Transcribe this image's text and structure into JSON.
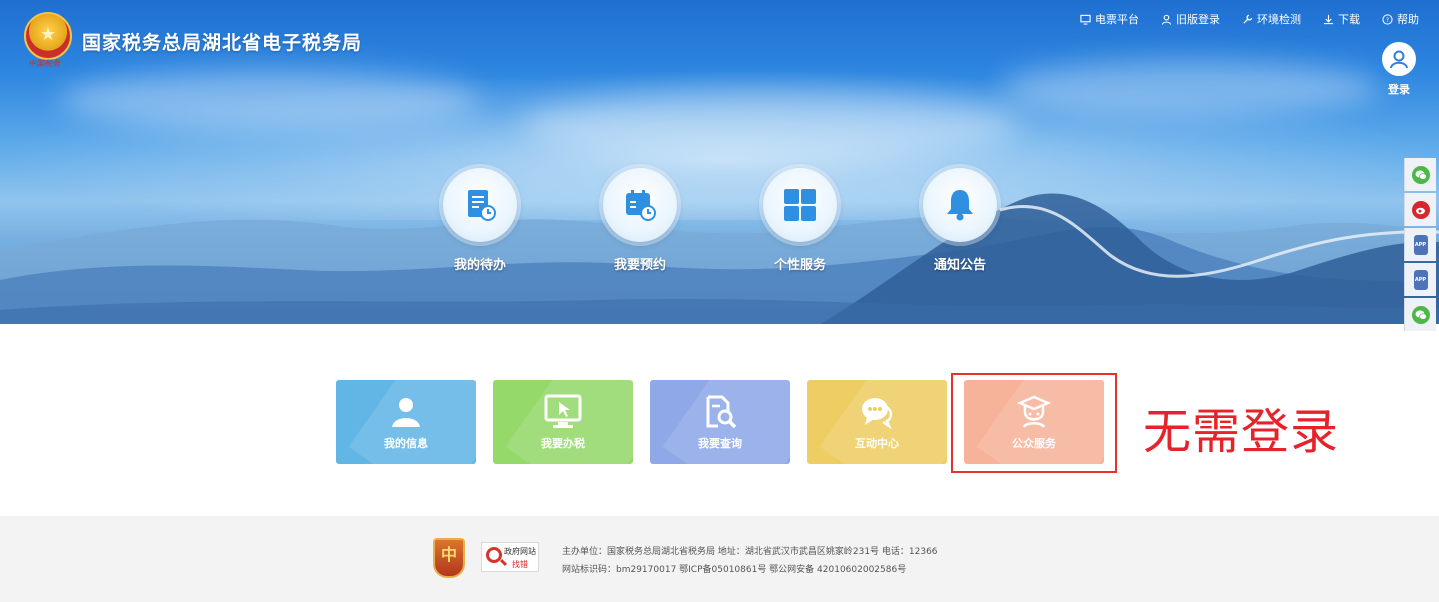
{
  "header": {
    "site_title": "国家税务总局湖北省电子税务局",
    "logo_signature": "中国税务"
  },
  "topnav": [
    {
      "label": "电票平台",
      "icon": "monitor-icon"
    },
    {
      "label": "旧版登录",
      "icon": "user-icon"
    },
    {
      "label": "环境检测",
      "icon": "wrench-icon"
    },
    {
      "label": "下载",
      "icon": "download-icon"
    },
    {
      "label": "帮助",
      "icon": "help-icon"
    }
  ],
  "login": {
    "label": "登录"
  },
  "quick_links": [
    {
      "label": "我的待办",
      "icon": "document-clock-icon"
    },
    {
      "label": "我要预约",
      "icon": "calendar-clock-icon"
    },
    {
      "label": "个性服务",
      "icon": "grid-icon"
    },
    {
      "label": "通知公告",
      "icon": "bell-icon"
    }
  ],
  "sidebar": [
    {
      "icon": "wechat-icon",
      "color": "#4cb848"
    },
    {
      "icon": "weibo-icon",
      "color": "#d6272d"
    },
    {
      "icon": "app-icon",
      "label": "APP",
      "color": "#4f73b8"
    },
    {
      "icon": "app-icon",
      "label": "APP",
      "color": "#4f73b8"
    },
    {
      "icon": "wechat-icon",
      "color": "#4cb848"
    }
  ],
  "tiles": [
    {
      "label": "我的信息",
      "icon": "person-icon",
      "color": "#62b6e6"
    },
    {
      "label": "我要办税",
      "icon": "monitor-cursor-icon",
      "color": "#96d96b"
    },
    {
      "label": "我要查询",
      "icon": "document-search-icon",
      "color": "#8fa8e8"
    },
    {
      "label": "互动中心",
      "icon": "chat-bubble-icon",
      "color": "#eecd63"
    },
    {
      "label": "公众服务",
      "icon": "graduate-icon",
      "color": "#f6b39a"
    }
  ],
  "annotation": {
    "text": "无需登录",
    "color": "#e6232a"
  },
  "footer": {
    "badge1_text": "中",
    "badge2_top": "政府网站",
    "badge2_bottom": "找错",
    "line1": "主办单位：国家税务总局湖北省税务局    地址：湖北省武汉市武昌区姚家岭231号  电话：12366",
    "line2": "网站标识码：bm29170017    鄂ICP备05010861号   鄂公网安备 42010602002586号"
  }
}
